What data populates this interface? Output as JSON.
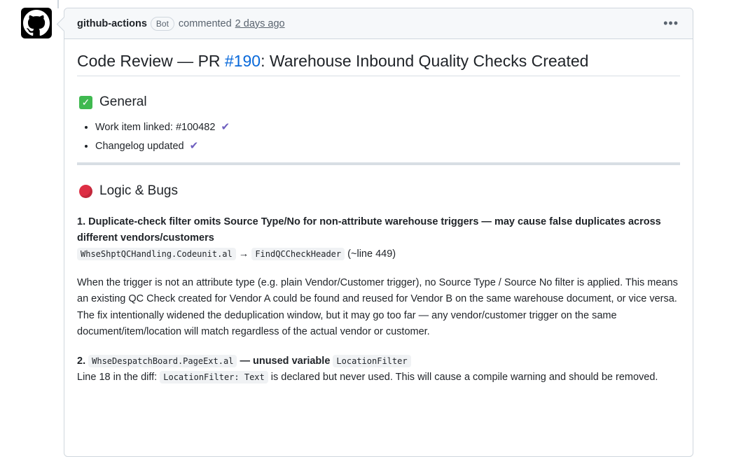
{
  "comment": {
    "author": "github-actions",
    "badge": "Bot",
    "action": "commented",
    "timestamp": "2 days ago",
    "more_label": "•••"
  },
  "title": {
    "prefix": "Code Review — PR ",
    "pr_link": "#190",
    "suffix": ": Warehouse Inbound Quality Checks Created"
  },
  "general": {
    "heading": "General",
    "items": [
      {
        "label": "Work item linked: ",
        "value": "#100482",
        "check": "✔"
      },
      {
        "label": "Changelog updated",
        "check": "✔"
      }
    ]
  },
  "logic": {
    "heading": "Logic & Bugs",
    "issue1": {
      "title": "1. Duplicate-check filter omits Source Type/No for non-attribute warehouse triggers — may cause false duplicates across different vendors/customers",
      "file": "WhseShptQCHandling.Codeunit.al",
      "arrow": "→",
      "func": "FindQCCheckHeader",
      "line": "(~line 449)",
      "description": "When the trigger is not an attribute type (e.g. plain Vendor/Customer trigger), no Source Type / Source No filter is applied. This means an existing QC Check created for Vendor A could be found and reused for Vendor B on the same warehouse document, or vice versa. The fix intentionally widened the deduplication window, but it may go too far — any vendor/customer trigger on the same document/item/location will match regardless of the actual vendor or customer."
    },
    "issue2": {
      "number": "2.",
      "file": "WhseDespatchBoard.PageExt.al",
      "dash_text": "— unused variable",
      "variable": "LocationFilter",
      "desc_prefix": "Line 18 in the diff:",
      "code": "LocationFilter: Text",
      "desc_suffix": "is declared but never used. This will cause a compile warning and should be removed."
    }
  },
  "colors": {
    "link": "#0969da",
    "check_purple": "#6e5fbf",
    "emoji_green": "#3fb950",
    "emoji_red": "#dd2e44"
  }
}
